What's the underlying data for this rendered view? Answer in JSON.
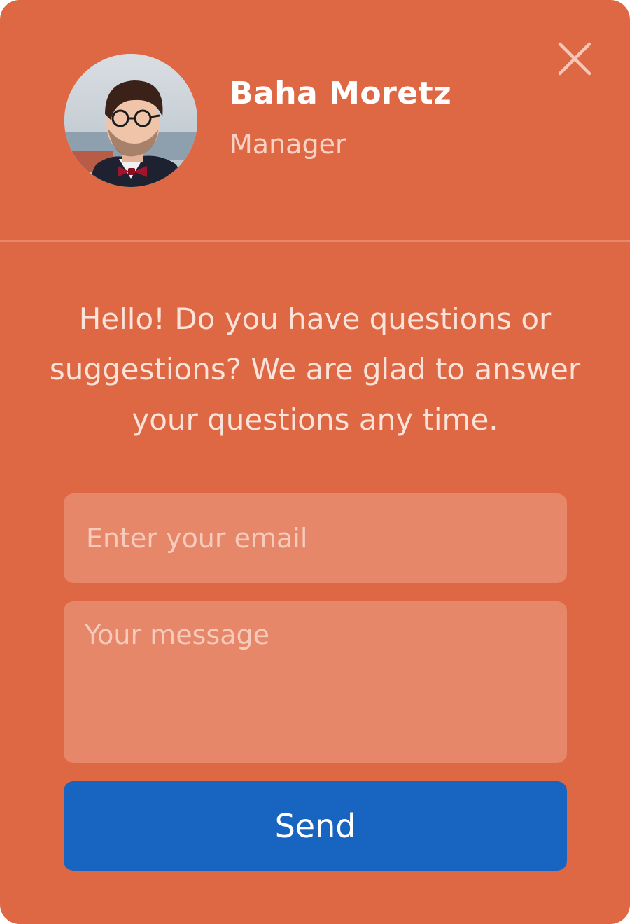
{
  "contact": {
    "name": "Baha Moretz",
    "role": "Manager",
    "avatar_icon": "avatar-photo"
  },
  "close_icon": "close-icon",
  "greeting": "Hello! Do you have questions or suggestions? We are glad to answer your questions any time.",
  "form": {
    "email_placeholder": "Enter your email",
    "message_placeholder": "Your message",
    "send_label": "Send"
  },
  "colors": {
    "background": "#DF6844",
    "field_background": "#E6876A",
    "button": "#1765C1"
  }
}
